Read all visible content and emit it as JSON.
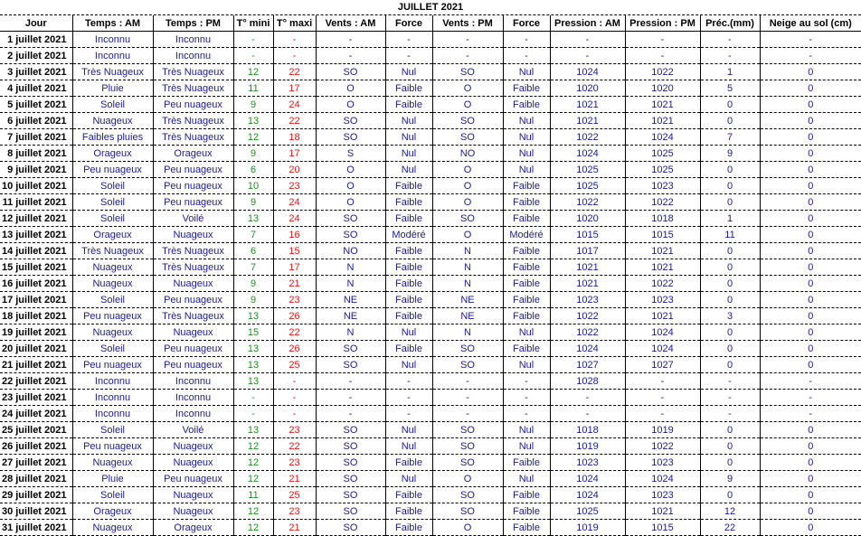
{
  "title": "JUILLET  2021",
  "headers": [
    "Jour",
    "Temps : AM",
    "Temps : PM",
    "T° mini",
    "T° maxi",
    "Vents : AM",
    "Force",
    "Vents : PM",
    "Force",
    "Pression : AM",
    "Pression : PM",
    "Préc.(mm)",
    "Neige au sol (cm)"
  ],
  "colors": {
    "text_blue": "#1a1a99",
    "tmin_green": "#1e8f1e",
    "tmax_red": "#e01818"
  },
  "rows": [
    [
      "1 juillet 2021",
      "Inconnu",
      "Inconnu",
      "-",
      "-",
      "-",
      "-",
      "-",
      "-",
      "-",
      "-",
      "-",
      "-"
    ],
    [
      "2 juillet 2021",
      "Inconnu",
      "Inconnu",
      "-",
      "-",
      "-",
      "-",
      "-",
      "-",
      "-",
      "-",
      "-",
      "-"
    ],
    [
      "3 juillet 2021",
      "Très Nuageux",
      "Très Nuageux",
      "12",
      "22",
      "SO",
      "Nul",
      "SO",
      "Nul",
      "1024",
      "1022",
      "1",
      "0"
    ],
    [
      "4 juillet 2021",
      "Pluie",
      "Très Nuageux",
      "11",
      "17",
      "O",
      "Faible",
      "O",
      "Faible",
      "1020",
      "1020",
      "5",
      "0"
    ],
    [
      "5 juillet 2021",
      "Soleil",
      "Peu nuageux",
      "9",
      "24",
      "O",
      "Faible",
      "O",
      "Faible",
      "1021",
      "1021",
      "0",
      "0"
    ],
    [
      "6 juillet 2021",
      "Nuageux",
      "Très Nuageux",
      "13",
      "22",
      "SO",
      "Nul",
      "SO",
      "Nul",
      "1021",
      "1021",
      "0",
      "0"
    ],
    [
      "7 juillet 2021",
      "Faibles pluies",
      "Très Nuageux",
      "12",
      "18",
      "SO",
      "Nul",
      "SO",
      "Nul",
      "1022",
      "1024",
      "7",
      "0"
    ],
    [
      "8 juillet 2021",
      "Orageux",
      "Orageux",
      "9",
      "17",
      "S",
      "Nul",
      "NO",
      "Nul",
      "1024",
      "1025",
      "9",
      "0"
    ],
    [
      "9 juillet 2021",
      "Peu nuageux",
      "Peu nuageux",
      "6",
      "20",
      "O",
      "Nul",
      "O",
      "Nul",
      "1025",
      "1025",
      "0",
      "0"
    ],
    [
      "10 juillet 2021",
      "Soleil",
      "Peu nuageux",
      "10",
      "23",
      "O",
      "Faible",
      "O",
      "Faible",
      "1025",
      "1023",
      "0",
      "0"
    ],
    [
      "11 juillet 2021",
      "Soleil",
      "Peu nuageux",
      "9",
      "24",
      "O",
      "Faible",
      "O",
      "Faible",
      "1022",
      "1022",
      "0",
      "0"
    ],
    [
      "12 juillet 2021",
      "Soleil",
      "Voilé",
      "13",
      "24",
      "SO",
      "Faible",
      "SO",
      "Faible",
      "1020",
      "1018",
      "1",
      "0"
    ],
    [
      "13 juillet 2021",
      "Orageux",
      "Nuageux",
      "7",
      "16",
      "SO",
      "Modéré",
      "O",
      "Modéré",
      "1015",
      "1015",
      "11",
      "0"
    ],
    [
      "14 juillet 2021",
      "Très Nuageux",
      "Très Nuageux",
      "6",
      "15",
      "NO",
      "Faible",
      "N",
      "Faible",
      "1017",
      "1021",
      "0",
      "0"
    ],
    [
      "15 juillet 2021",
      "Nuageux",
      "Très Nuageux",
      "7",
      "17",
      "N",
      "Faible",
      "N",
      "Faible",
      "1021",
      "1021",
      "0",
      "0"
    ],
    [
      "16 juillet 2021",
      "Nuageux",
      "Nuageux",
      "9",
      "21",
      "N",
      "Faible",
      "N",
      "Faible",
      "1021",
      "1022",
      "0",
      "0"
    ],
    [
      "17 juillet 2021",
      "Soleil",
      "Peu nuageux",
      "9",
      "23",
      "NE",
      "Faible",
      "NE",
      "Faible",
      "1023",
      "1023",
      "0",
      "0"
    ],
    [
      "18 juillet 2021",
      "Peu nuageux",
      "Très Nuageux",
      "13",
      "26",
      "NE",
      "Faible",
      "NE",
      "Faible",
      "1022",
      "1021",
      "3",
      "0"
    ],
    [
      "19 juillet 2021",
      "Nuageux",
      "Nuageux",
      "15",
      "22",
      "N",
      "Nul",
      "N",
      "Nul",
      "1022",
      "1024",
      "0",
      "0"
    ],
    [
      "20 juillet 2021",
      "Soleil",
      "Peu nuageux",
      "13",
      "26",
      "SO",
      "Faible",
      "SO",
      "Faible",
      "1024",
      "1024",
      "0",
      "0"
    ],
    [
      "21 juillet 2021",
      "Peu nuageux",
      "Peu nuageux",
      "13",
      "25",
      "SO",
      "Nul",
      "SO",
      "Nul",
      "1027",
      "1027",
      "0",
      "0"
    ],
    [
      "22 juillet 2021",
      "Inconnu",
      "Inconnu",
      "13",
      "-",
      "-",
      "-",
      "-",
      "-",
      "1028",
      "-",
      "-",
      "-"
    ],
    [
      "23 juillet 2021",
      "Inconnu",
      "Inconnu",
      "-",
      "-",
      "-",
      "-",
      "-",
      "-",
      "-",
      "-",
      "-",
      "-"
    ],
    [
      "24 juillet 2021",
      "Inconnu",
      "Inconnu",
      "-",
      "-",
      "-",
      "-",
      "-",
      "-",
      "-",
      "-",
      "-",
      "-"
    ],
    [
      "25 juillet 2021",
      "Soleil",
      "Voilé",
      "13",
      "23",
      "SO",
      "Nul",
      "SO",
      "Nul",
      "1018",
      "1019",
      "0",
      "0"
    ],
    [
      "26 juillet 2021",
      "Peu nuageux",
      "Nuageux",
      "12",
      "22",
      "SO",
      "Nul",
      "SO",
      "Nul",
      "1019",
      "1022",
      "0",
      "0"
    ],
    [
      "27 juillet 2021",
      "Nuageux",
      "Nuageux",
      "12",
      "23",
      "SO",
      "Faible",
      "SO",
      "Faible",
      "1023",
      "1023",
      "0",
      "0"
    ],
    [
      "28 juillet 2021",
      "Pluie",
      "Peu nuageux",
      "12",
      "21",
      "SO",
      "Nul",
      "O",
      "Nul",
      "1024",
      "1024",
      "9",
      "0"
    ],
    [
      "29 juillet 2021",
      "Soleil",
      "Nuageux",
      "11",
      "25",
      "SO",
      "Faible",
      "SO",
      "Faible",
      "1024",
      "1023",
      "0",
      "0"
    ],
    [
      "30 juillet 2021",
      "Orageux",
      "Nuageux",
      "12",
      "23",
      "SO",
      "Faible",
      "SO",
      "Faible",
      "1025",
      "1021",
      "12",
      "0"
    ],
    [
      "31 juillet 2021",
      "Nuageux",
      "Orageux",
      "12",
      "21",
      "SO",
      "Faible",
      "O",
      "Faible",
      "1019",
      "1015",
      "22",
      "0"
    ]
  ]
}
